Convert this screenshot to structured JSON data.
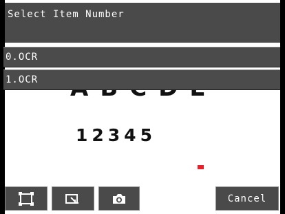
{
  "dialog": {
    "title": "Select Item Number",
    "items": [
      {
        "label": "0.OCR"
      },
      {
        "label": "1.OCR"
      }
    ]
  },
  "image": {
    "letters_text": "ABCDE",
    "digits_text": "12345",
    "marker_color": "#e8202a"
  },
  "toolbar": {
    "buttons": [
      {
        "icon": "fit-window-icon"
      },
      {
        "icon": "zoom-icon"
      },
      {
        "icon": "camera-icon"
      }
    ],
    "cancel_label": "Cancel"
  }
}
